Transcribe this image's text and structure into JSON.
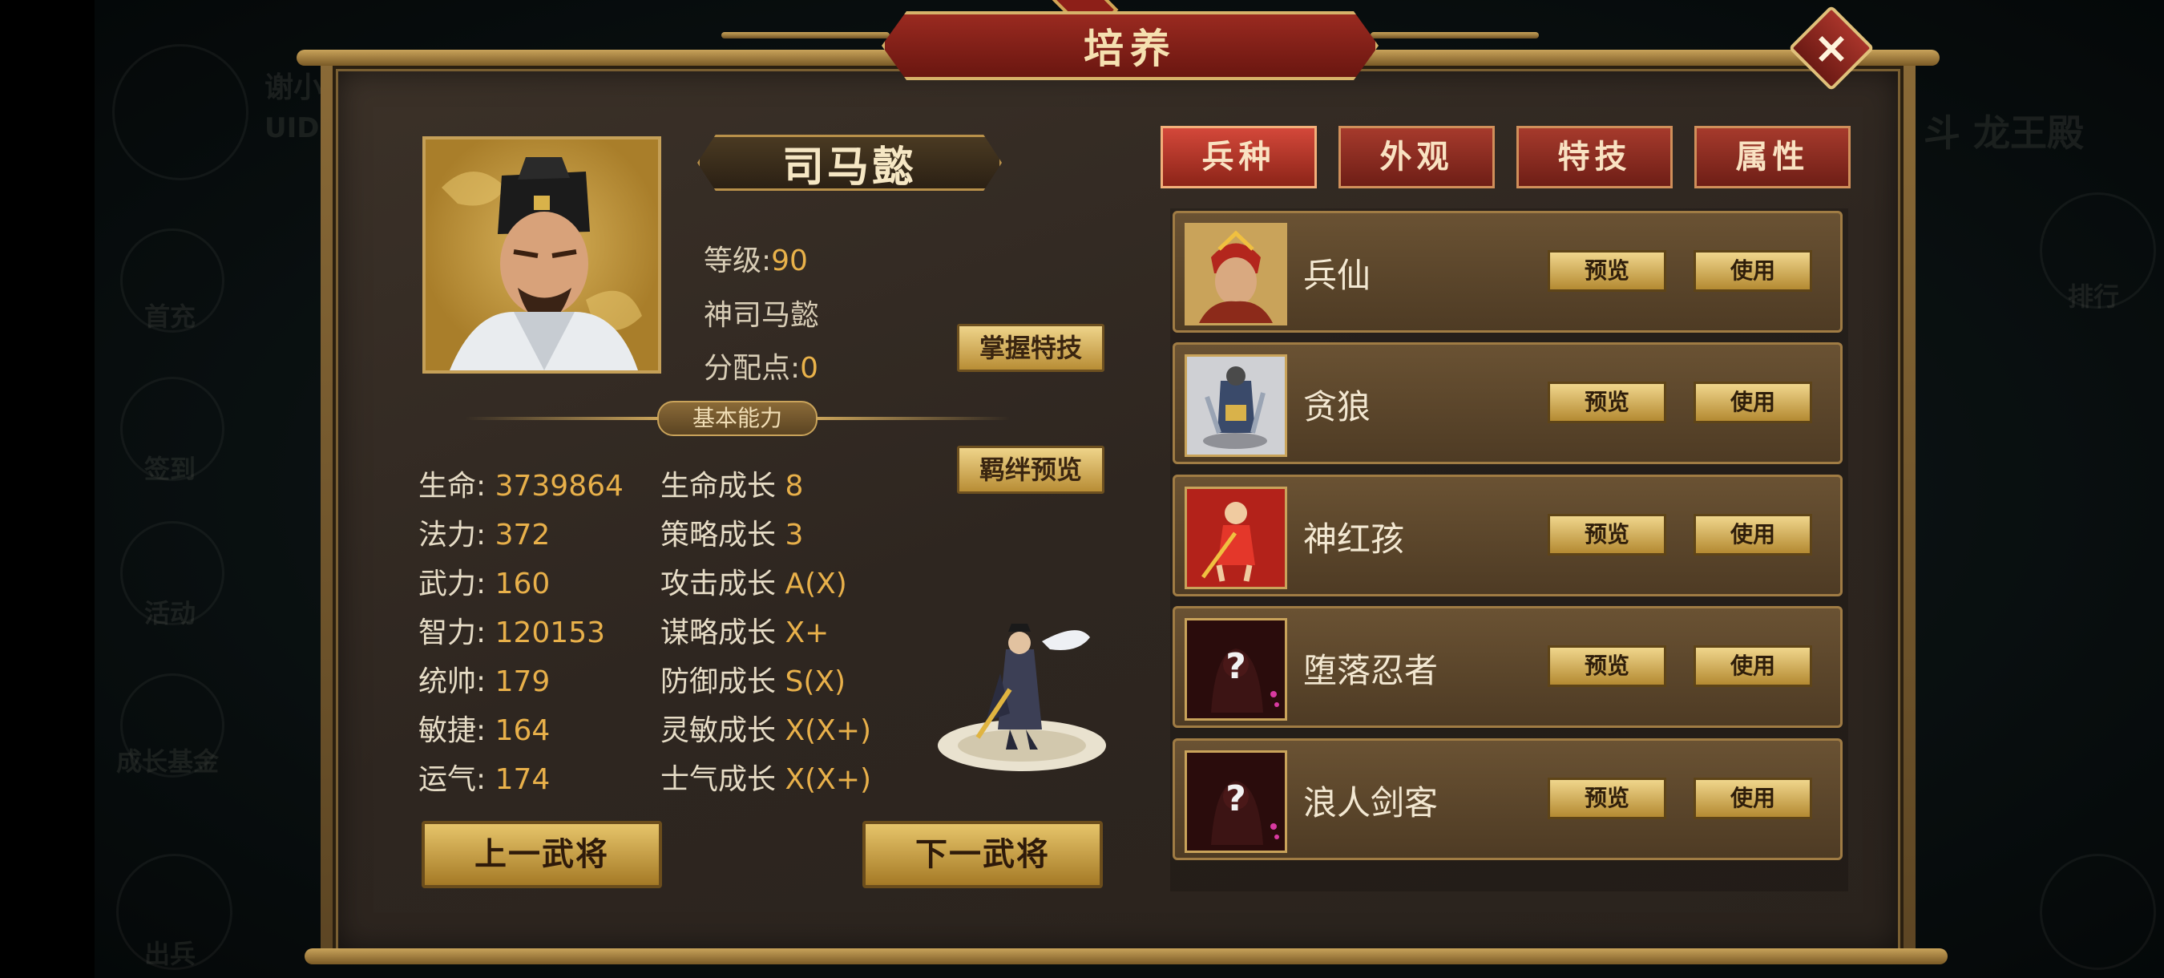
{
  "window": {
    "title": "培养",
    "close_icon": "×"
  },
  "background": {
    "left_name": "谢小",
    "uid_label": "UID",
    "right_text": "斗 龙王殿",
    "side_items": [
      "首充",
      "签到",
      "活动",
      "成长基金",
      "出兵",
      "排行"
    ]
  },
  "hero": {
    "name": "司马懿",
    "level_label": "等级:",
    "level_value": "90",
    "title": "神司马懿",
    "points_label": "分配点:",
    "points_value": "0"
  },
  "buttons": {
    "master_skill": "掌握特技",
    "bond_preview": "羁绊预览",
    "prev_general": "上一武将",
    "next_general": "下一武将"
  },
  "section": {
    "basic_ability": "基本能力"
  },
  "stats": [
    {
      "label": "生命:",
      "value": "3739864"
    },
    {
      "label": "法力:",
      "value": "372"
    },
    {
      "label": "武力:",
      "value": "160"
    },
    {
      "label": "智力:",
      "value": "120153"
    },
    {
      "label": "统帅:",
      "value": "179"
    },
    {
      "label": "敏捷:",
      "value": "164"
    },
    {
      "label": "运气:",
      "value": "174"
    }
  ],
  "growth": [
    {
      "label": "生命成长",
      "value": "8"
    },
    {
      "label": "策略成长",
      "value": "3"
    },
    {
      "label": "攻击成长",
      "value": "A(X)"
    },
    {
      "label": "谋略成长",
      "value": "X+"
    },
    {
      "label": "防御成长",
      "value": "S(X)"
    },
    {
      "label": "灵敏成长",
      "value": "X(X+)"
    },
    {
      "label": "士气成长",
      "value": "X(X+)"
    }
  ],
  "tabs": [
    "兵种",
    "外观",
    "特技",
    "属性"
  ],
  "troops": [
    {
      "name": "兵仙",
      "preview": "预览",
      "use": "使用",
      "locked": false
    },
    {
      "name": "贪狼",
      "preview": "预览",
      "use": "使用",
      "locked": false
    },
    {
      "name": "神红孩",
      "preview": "预览",
      "use": "使用",
      "locked": false
    },
    {
      "name": "堕落忍者",
      "preview": "预览",
      "use": "使用",
      "locked": true
    },
    {
      "name": "浪人剑客",
      "preview": "预览",
      "use": "使用",
      "locked": true
    }
  ],
  "colors": {
    "accent_gold": "#e8b04a",
    "tab_red": "#a63a2c",
    "panel_bg": "#2e2620"
  }
}
